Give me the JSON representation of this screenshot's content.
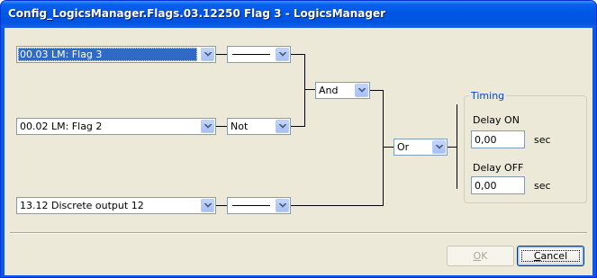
{
  "window": {
    "title": "Config_LogicsManager.Flags.03.12250 Flag 3 - LogicsManager"
  },
  "inputs": [
    {
      "value": "00.03 LM: Flag 3",
      "selected": true
    },
    {
      "value": "00.02 LM: Flag 2",
      "selected": false
    },
    {
      "value": "13.12 Discrete output 12",
      "selected": false
    }
  ],
  "operators": {
    "op1": "",
    "op2": "Not",
    "op3": "",
    "gate_and": "And",
    "gate_or": "Or"
  },
  "timing": {
    "legend": "Timing",
    "delay_on_label": "Delay ON",
    "delay_on_value": "0,00",
    "delay_on_unit": "sec",
    "delay_off_label": "Delay OFF",
    "delay_off_value": "0,00",
    "delay_off_unit": "sec"
  },
  "buttons": {
    "ok_mnemonic": "O",
    "ok_rest": "K",
    "ok_enabled": false,
    "cancel_mnemonic": "C",
    "cancel_rest": "ancel"
  },
  "icons": {
    "dropdown": "chevron-down-icon"
  },
  "colors": {
    "title_bar": "#0054e0",
    "face": "#ece9d8",
    "selection": "#316ac5",
    "group_title": "#0046d5"
  }
}
